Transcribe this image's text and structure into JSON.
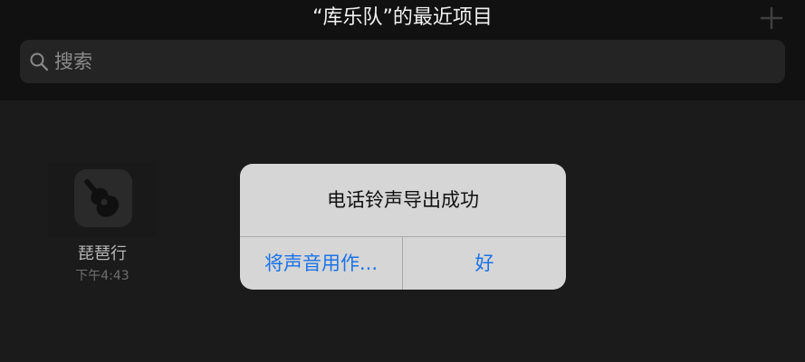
{
  "header": {
    "title": "“库乐队”的最近项目",
    "add_icon": "plus-icon"
  },
  "search": {
    "placeholder": "搜索",
    "icon": "search-icon"
  },
  "project": {
    "name": "琵琶行",
    "time": "下午4:43",
    "icon": "guitar-icon"
  },
  "alert": {
    "title": "电话铃声导出成功",
    "buttons": [
      {
        "label": "将声音用作..."
      },
      {
        "label": "好"
      }
    ],
    "accent_color": "#1a73e8"
  }
}
